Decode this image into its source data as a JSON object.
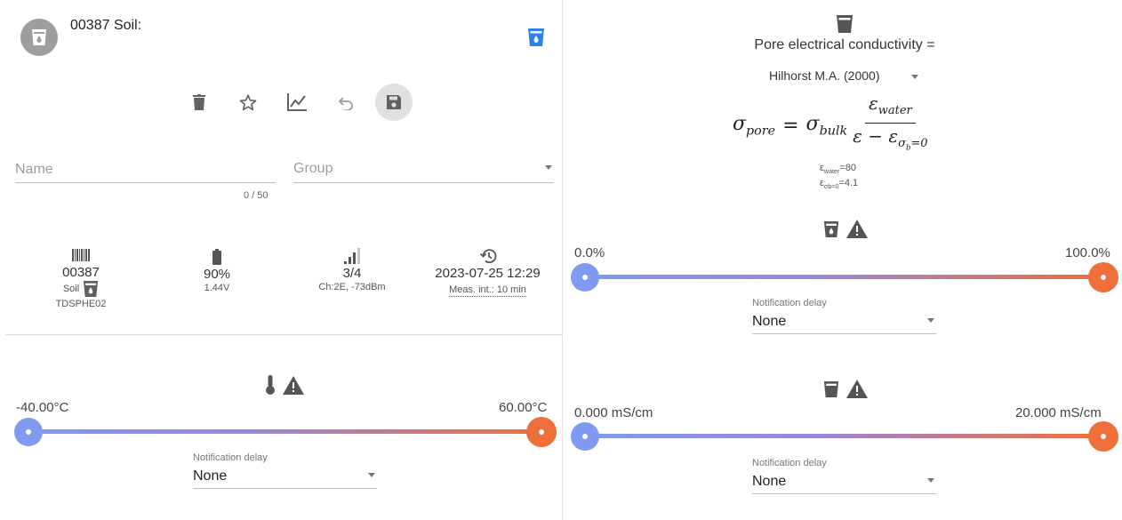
{
  "device": {
    "title": "00387 Soil:",
    "colors": {
      "accent": "#2f80ed",
      "avatar": "#9e9e9e",
      "low": "#7f9af0",
      "high": "#ee6f3a"
    }
  },
  "fields": {
    "name_placeholder": "Name",
    "name_counter": "0 / 50",
    "group_placeholder": "Group"
  },
  "stats": {
    "id": {
      "value": "00387",
      "type_label": "Soil",
      "model": "TDSPHE02"
    },
    "battery": {
      "value": "90%",
      "voltage": "1.44V"
    },
    "signal": {
      "value": "3/4",
      "detail": "Ch:2E, -73dBm"
    },
    "last_seen": {
      "value": "2023-07-25 12:29",
      "interval": "Meas. int.: 10 min"
    }
  },
  "temperature_alarm": {
    "min_label": "-40.00°C",
    "max_label": "60.00°C",
    "notification_label": "Notification delay",
    "notification_value": "None"
  },
  "pore": {
    "title": "Pore electrical conductivity =",
    "model": "Hilhorst M.A. (2000)",
    "eps_water": "80",
    "eps_ob0": "4.1"
  },
  "water_alarm": {
    "min_label": "0.0%",
    "max_label": "100.0%",
    "notification_label": "Notification delay",
    "notification_value": "None"
  },
  "ec_alarm": {
    "min_label": "0.000 mS/cm",
    "max_label": "20.000 mS/cm",
    "notification_label": "Notification delay",
    "notification_value": "None"
  }
}
